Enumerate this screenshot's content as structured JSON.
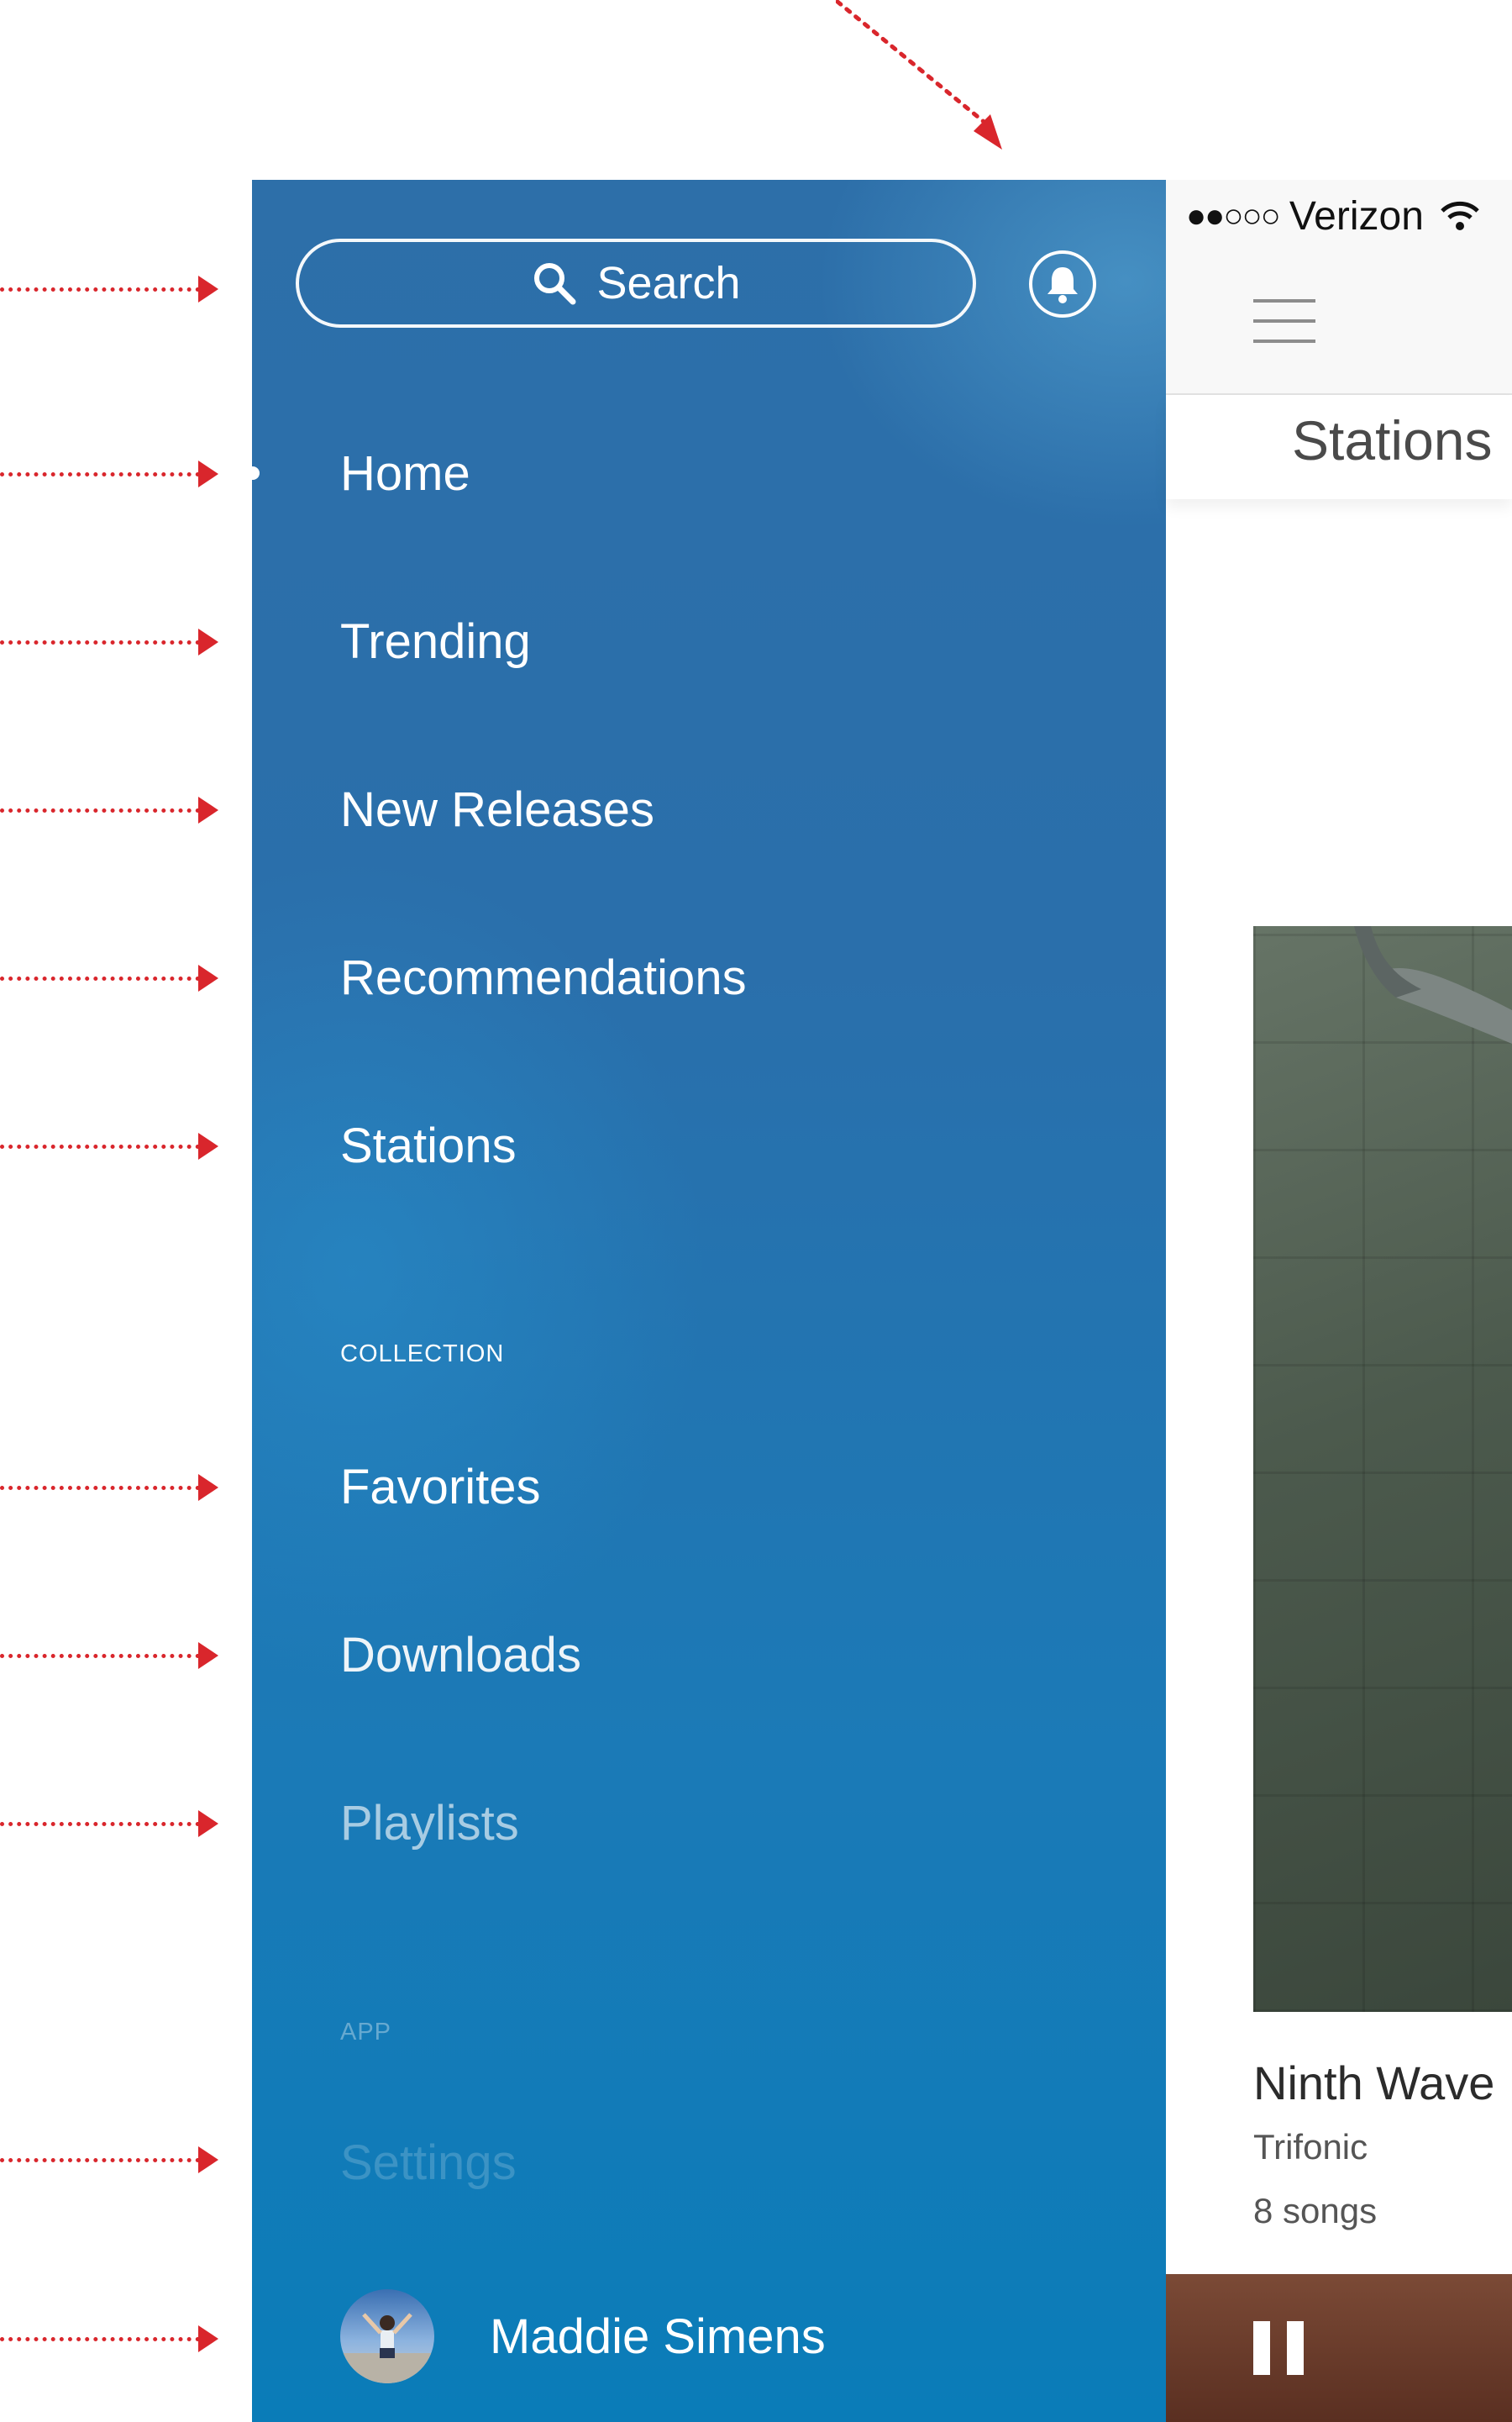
{
  "drawer": {
    "search": {
      "label": "Search"
    },
    "nav": {
      "home": "Home",
      "trending": "Trending",
      "new_releases": "New Releases",
      "recommendations": "Recommendations",
      "stations": "Stations"
    },
    "collection": {
      "heading": "COLLECTION",
      "favorites": "Favorites",
      "downloads": "Downloads",
      "playlists": "Playlists"
    },
    "app": {
      "heading": "APP",
      "settings": "Settings"
    },
    "profile": {
      "name": "Maddie Simens"
    }
  },
  "status_bar": {
    "signal": "●●○○○",
    "carrier": "Verizon"
  },
  "app": {
    "page_title": "Stations",
    "album": {
      "title": "Ninth Wave",
      "artist": "Trifonic",
      "song_count": "8 songs"
    }
  },
  "colors": {
    "annotation_red": "#d9262c",
    "drawer_blue": "#1b7ab7",
    "player_brown": "#6b3a2a"
  }
}
